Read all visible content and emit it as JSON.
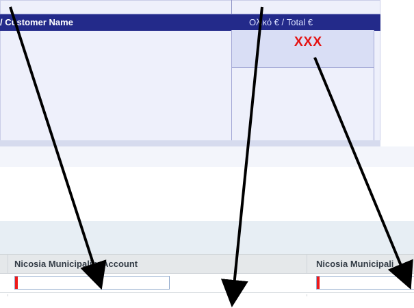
{
  "bill_table": {
    "customer_name_header": "/ Customer Name",
    "total_header": "Ολικό € / Total €",
    "total_value": "XXX"
  },
  "account_section": {
    "fields": [
      {
        "label": "Nicosia Municipality Account",
        "value": "",
        "required": true
      },
      {
        "label": "Nicosia Municipali",
        "value": "",
        "required": true
      }
    ]
  },
  "annotations": {
    "arrow_color": "#000000",
    "arrows": [
      "arrow-to-account-field-1",
      "arrow-to-bottom-center",
      "arrow-to-account-field-2"
    ]
  },
  "colors": {
    "header_bar": "#232a8a",
    "total_value": "#e41212",
    "required_marker": "#ee1a1a"
  }
}
